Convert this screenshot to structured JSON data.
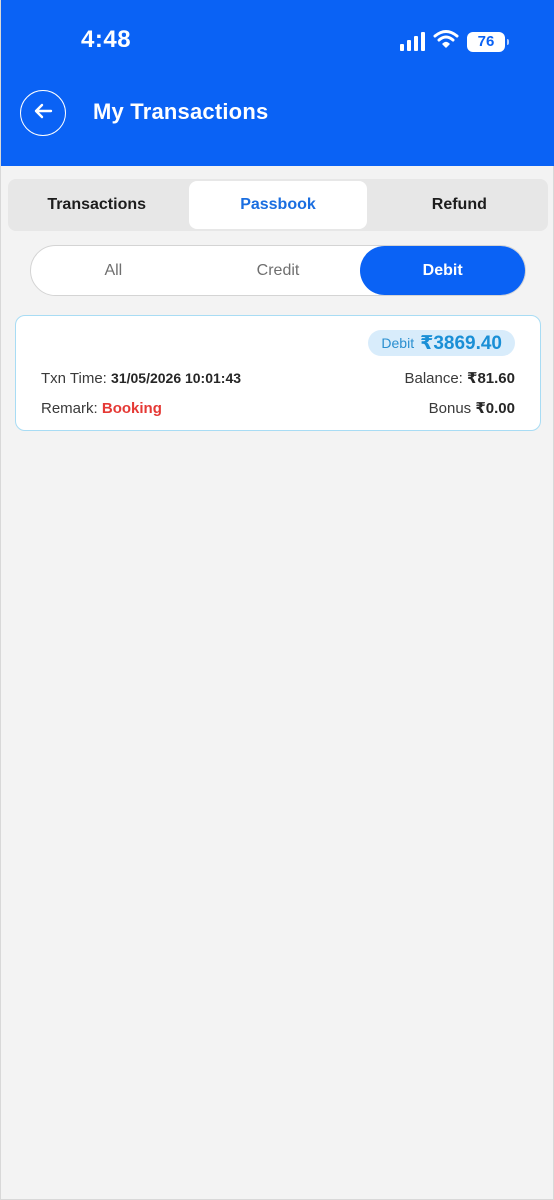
{
  "status_bar": {
    "time": "4:48",
    "battery": "76",
    "icons": [
      "signal-icon",
      "wifi-icon",
      "battery-icon"
    ]
  },
  "header": {
    "title": "My Transactions",
    "back_icon": "arrow-left-icon"
  },
  "main_tabs": [
    {
      "label": "Transactions",
      "active": false
    },
    {
      "label": "Passbook",
      "active": true
    },
    {
      "label": "Refund",
      "active": false
    }
  ],
  "filter_tabs": [
    {
      "label": "All",
      "active": false
    },
    {
      "label": "Credit",
      "active": false
    },
    {
      "label": "Debit",
      "active": true
    }
  ],
  "transactions": [
    {
      "type": "Debit",
      "amount": "₹3869.40",
      "txn_time_label": "Txn Time:",
      "txn_time": "31/05/2026 10:01:43",
      "balance_label": "Balance:",
      "balance": "₹81.60",
      "remark_label": "Remark:",
      "remark": "Booking",
      "bonus_label": "Bonus",
      "bonus": "₹0.00"
    }
  ],
  "colors": {
    "header": "#0a62f5",
    "active_tab_text": "#1a6ee0",
    "card_border": "#a8dcf4",
    "amount": "#1a8fd6",
    "remark": "#e53935",
    "background": "#f3f3f3"
  }
}
